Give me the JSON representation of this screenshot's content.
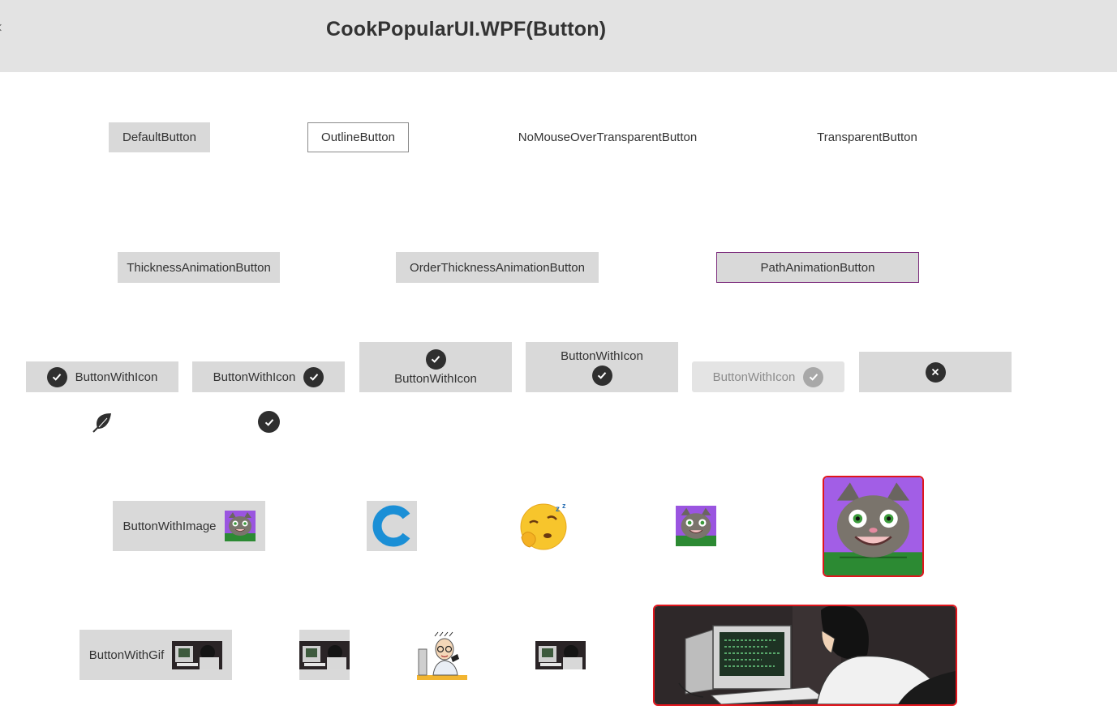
{
  "header": {
    "title": "CookPopularUI.WPF(Button)"
  },
  "row1": {
    "default_button": "DefaultButton",
    "outline_button": "OutlineButton",
    "no_mouse_over_button": "NoMouseOverTransparentButton",
    "transparent_button": "TransparentButton"
  },
  "row2": {
    "thickness_button": "ThicknessAnimationButton",
    "order_thickness_button": "OrderThicknessAnimationButton",
    "path_button": "PathAnimationButton"
  },
  "icon_buttons": {
    "label": "ButtonWithIcon",
    "icon": "check-circle-icon",
    "close_icon": "close-circle-icon",
    "leaf_icon": "leaf-icon"
  },
  "image_buttons": {
    "label": "ButtonWithImage"
  },
  "gif_buttons": {
    "label": "ButtonWithGif"
  },
  "colors": {
    "header_bg": "#e3e3e3",
    "button_bg": "#d9d9d9",
    "accent_purple": "#7b2a7b",
    "highlight_red": "#e0151c"
  }
}
